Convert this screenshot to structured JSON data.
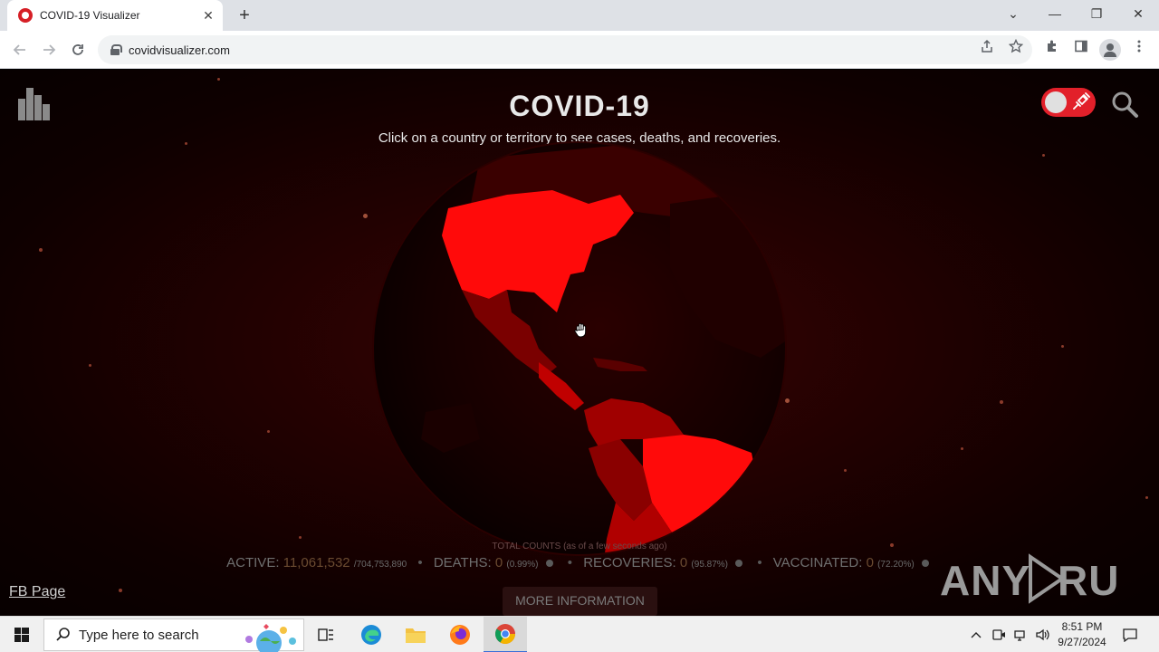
{
  "browser": {
    "tab_title": "COVID-19 Visualizer",
    "tab_close": "✕",
    "new_tab": "+",
    "url": "covidvisualizer.com",
    "window_controls": {
      "list": "⌄",
      "minimize": "—",
      "restore": "❐",
      "close": "✕"
    }
  },
  "page": {
    "title": "COVID-19",
    "subtitle": "Click on a country or territory to see cases, deaths, and recoveries.",
    "total_label": "TOTAL COUNTS (as of a few seconds ago)",
    "stats": {
      "active_label": "ACTIVE:",
      "active_value": "11,061,532",
      "active_total": "/704,753,890",
      "deaths_label": "DEATHS:",
      "deaths_value": "0",
      "deaths_pct": "(0.99%)",
      "recoveries_label": "RECOVERIES:",
      "recoveries_value": "0",
      "recoveries_pct": "(95.87%)",
      "vaccinated_label": "VACCINATED:",
      "vaccinated_value": "0",
      "vaccinated_pct": "(72.20%)"
    },
    "fb_link": "FB Page",
    "more_button": "MORE INFORMATION",
    "watermark": "ANY RUN",
    "colors": {
      "accent": "#e2202a",
      "background": "#220101",
      "land_highlight": "#ff0a0a",
      "land_mid": "#a00000",
      "land_dark": "#3a0000"
    }
  },
  "taskbar": {
    "search_placeholder": "Type here to search",
    "time": "8:51 PM",
    "date": "9/27/2024"
  }
}
